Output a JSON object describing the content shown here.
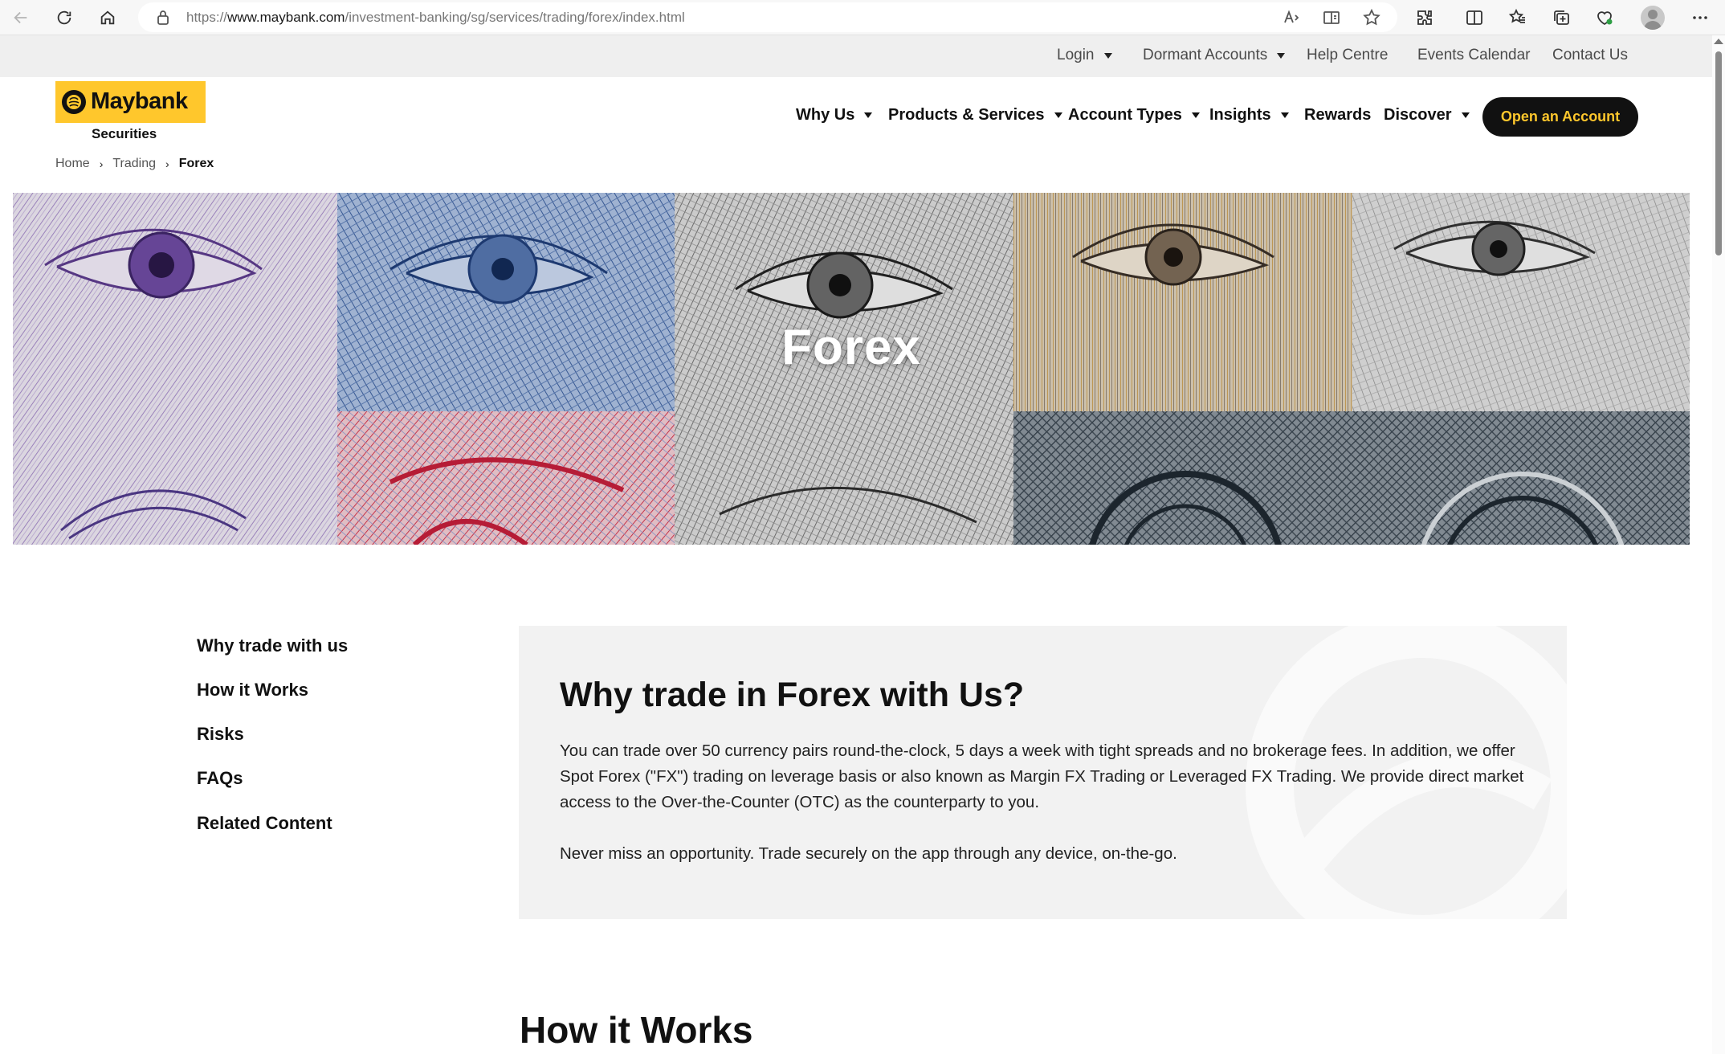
{
  "browser": {
    "url_prefix": "https://",
    "url_host": "www.maybank.com",
    "url_path": "/investment-banking/sg/services/trading/forex/index.html"
  },
  "utility_nav": {
    "login": "Login",
    "dormant_accounts": "Dormant Accounts",
    "help_centre": "Help Centre",
    "events_calendar": "Events Calendar",
    "contact_us": "Contact Us"
  },
  "brand": {
    "name": "Maybank",
    "sub": "Securities",
    "color": "#ffc72c"
  },
  "main_nav": {
    "why_us": "Why Us",
    "products_services": "Products & Services",
    "account_types": "Account Types",
    "insights": "Insights",
    "rewards": "Rewards",
    "discover": "Discover",
    "cta": "Open an Account"
  },
  "breadcrumb": {
    "home": "Home",
    "trading": "Trading",
    "current": "Forex"
  },
  "hero": {
    "title": "Forex"
  },
  "sidebar": {
    "items": [
      {
        "label": "Why trade with us"
      },
      {
        "label": "How it Works"
      },
      {
        "label": "Risks"
      },
      {
        "label": "FAQs"
      },
      {
        "label": "Related Content"
      }
    ]
  },
  "why_section": {
    "title": "Why trade in Forex with Us?",
    "paragraph_1": "You can trade over 50 currency pairs round-the-clock, 5 days a week with tight spreads and no brokerage fees. In addition, we offer Spot Forex (\"FX\") trading on leverage basis or also known as Margin FX Trading or Leveraged FX Trading. We provide direct market access to the Over-the-Counter (OTC) as the counterparty to you.",
    "paragraph_2": "Never miss an opportunity. Trade securely on the app through any device, on-the-go."
  },
  "how_section": {
    "title": "How it Works"
  }
}
